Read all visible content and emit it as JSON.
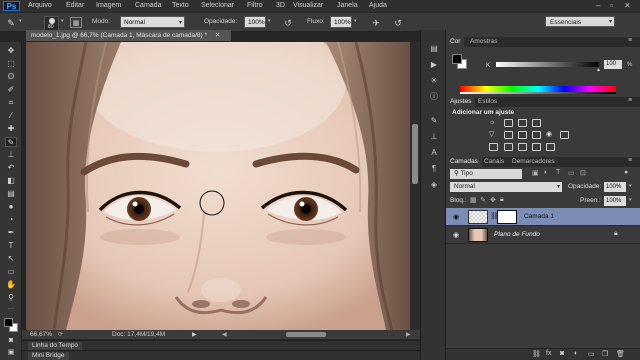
{
  "app": {
    "logo": "Ps"
  },
  "menu": [
    "Arquivo",
    "Editar",
    "Imagem",
    "Camada",
    "Texto",
    "Selecionar",
    "Filtro",
    "3D",
    "Visualizar",
    "Janela",
    "Ajuda"
  ],
  "options": {
    "brush_size": "80",
    "mode_label": "Modo:",
    "mode_value": "Normal",
    "opacity_label": "Opacidade:",
    "opacity_value": "100%",
    "flow_label": "Fluxo:",
    "flow_value": "100%"
  },
  "workspace": "Essenciais",
  "document": {
    "tab_title": "modelo_1.jpg @ 66,7% (Camada 1, Máscara de camada/8) *",
    "zoom": "66,67%",
    "doc_size": "Doc: 17,4M/19,4M"
  },
  "bottom_tabs": {
    "timeline": "Linha do Tempo",
    "bridge": "Mini Bridge"
  },
  "color_panel": {
    "tabs": [
      "Cor",
      "Amostras"
    ],
    "channel_label": "K",
    "channel_value": "100",
    "percent": "%"
  },
  "adjustments_panel": {
    "tabs": [
      "Ajustes",
      "Estilos"
    ],
    "heading": "Adicionar um ajuste"
  },
  "layers_panel": {
    "tabs": [
      "Camadas",
      "Canais",
      "Demarcadores"
    ],
    "filter_label": "Tipo",
    "blend_mode": "Normal",
    "opacity_label": "Opacidade:",
    "opacity_value": "100%",
    "lock_label": "Bloq.:",
    "fill_label": "Preen.:",
    "fill_value": "100%",
    "layers": [
      {
        "name": "Camada 1",
        "selected": true
      },
      {
        "name": "Plano de Fundo",
        "selected": false
      }
    ]
  },
  "colors": {
    "accent_selection": "#7b8db4",
    "panel_bg": "#3a3a3a",
    "logo_blue": "#4fa3ff"
  }
}
